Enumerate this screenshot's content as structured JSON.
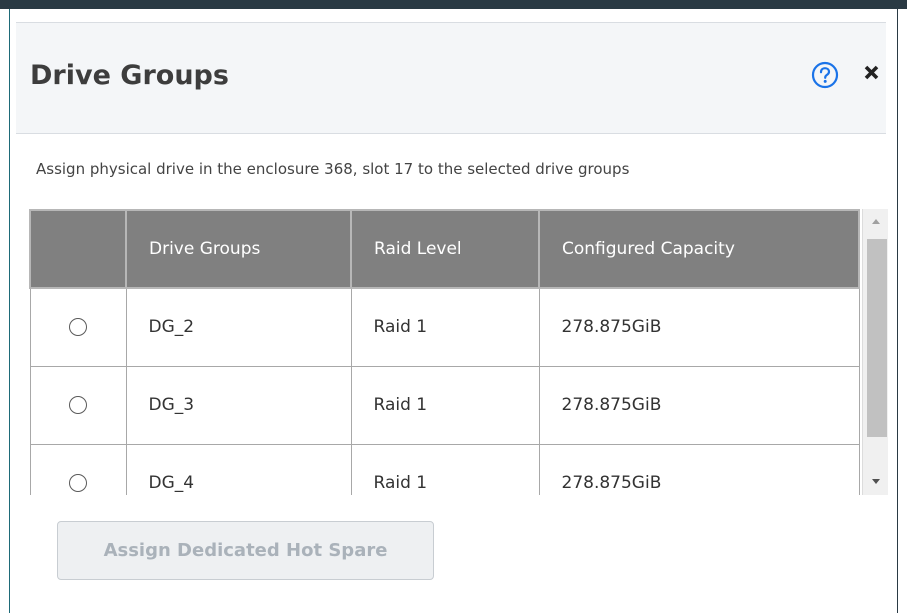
{
  "dialog": {
    "title": "Drive Groups",
    "description": "Assign physical drive in the enclosure 368, slot 17 to the selected drive groups",
    "help_icon": "question-circle-icon",
    "close_icon": "close-x-icon",
    "accent_color": "#1a73e8"
  },
  "table": {
    "columns": [
      "",
      "Drive Groups",
      "Raid Level",
      "Configured Capacity"
    ],
    "rows": [
      {
        "selected": false,
        "drive_group": "DG_2",
        "raid_level": "Raid 1",
        "capacity": "278.875GiB"
      },
      {
        "selected": false,
        "drive_group": "DG_3",
        "raid_level": "Raid 1",
        "capacity": "278.875GiB"
      },
      {
        "selected": false,
        "drive_group": "DG_4",
        "raid_level": "Raid 1",
        "capacity": "278.875GiB"
      }
    ]
  },
  "actions": {
    "assign_label": "Assign Dedicated Hot Spare",
    "assign_enabled": false
  }
}
